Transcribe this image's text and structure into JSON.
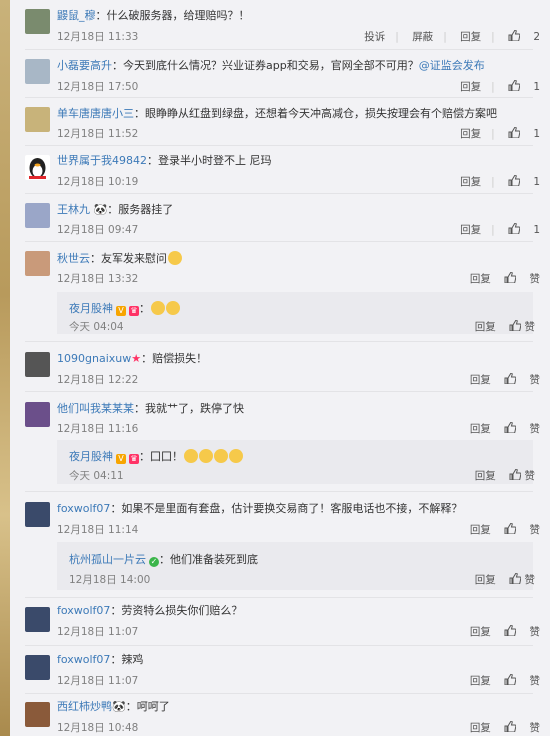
{
  "comments": [
    {
      "user": "鼹鼠_穆",
      "text": "：什么破服务器，给理赔吗？！",
      "time": "12月18日 11:33",
      "report": "投诉",
      "block": "屏蔽",
      "reply": "回复",
      "likes": "2",
      "avatar_color": "#7a8b6e"
    },
    {
      "user": "小磊要高升",
      "text": "：今天到底什么情况？兴业证券app和交易，官网全部不可用？",
      "link": "@证监会发布",
      "time": "12月18日 17:50",
      "reply": "回复",
      "likes": "1",
      "avatar_color": "#a8b7c6"
    },
    {
      "user": "单车唐唐唐小三",
      "text": "：眼睁睁从红盘到绿盘，还想着今天冲高减仓，损失按理会有个赔偿方案吧",
      "time": "12月18日 11:52",
      "reply": "回复",
      "likes": "1",
      "avatar_color": "#c8b37a"
    },
    {
      "user": "世界属于我49842",
      "text": "：登录半小时登不上 尼玛",
      "time": "12月18日 10:19",
      "reply": "回复",
      "likes": "1",
      "avatar_color": "#222222"
    },
    {
      "user": "王林九",
      "text": "：服务器挂了",
      "time": "12月18日 09:47",
      "reply": "回复",
      "likes": "1",
      "avatar_color": "#9aa6c8"
    },
    {
      "user": "秋世云",
      "text": "：友军发来慰问",
      "time": "12月18日 13:32",
      "reply": "回复",
      "like": "赞",
      "avatar_color": "#c99a7a",
      "sub": {
        "user": "夜月股神",
        "text": "：",
        "time": "今天 04:04",
        "reply": "回复",
        "like": "赞"
      }
    },
    {
      "user": "1090gnaixuw",
      "text": "：赔偿损失！",
      "time": "12月18日 12:22",
      "reply": "回复",
      "like": "赞",
      "avatar_color": "#555555"
    },
    {
      "user": "他们叫我某某某",
      "text": "：我就艹了，跌停了快",
      "time": "12月18日 11:16",
      "reply": "回复",
      "like": "赞",
      "avatar_color": "#6b4f8a",
      "sub": {
        "user": "夜月股神",
        "text": "：囗囗！",
        "time": "今天 04:11",
        "reply": "回复",
        "like": "赞"
      }
    },
    {
      "user": "foxwolf07",
      "text": "：如果不是里面有套盘，估计要换交易商了！客服电话也不接，不解释？",
      "time": "12月18日 11:14",
      "reply": "回复",
      "like": "赞",
      "avatar_color": "#3a4a6a",
      "sub": {
        "user": "杭州孤山一片云",
        "text": "：他们准备装死到底",
        "time": "12月18日 14:00",
        "reply": "回复",
        "like": "赞"
      }
    },
    {
      "user": "foxwolf07",
      "text": "：劳资特么损失你们赔么？",
      "time": "12月18日 11:07",
      "reply": "回复",
      "like": "赞",
      "avatar_color": "#3a4a6a"
    },
    {
      "user": "foxwolf07",
      "text": "：辣鸡",
      "time": "12月18日 11:07",
      "reply": "回复",
      "like": "赞",
      "avatar_color": "#3a4a6a"
    },
    {
      "user": "西红柿炒鸭",
      "text": "：呵呵了",
      "time": "12月18日 10:48",
      "reply": "回复",
      "like": "赞",
      "avatar_color": "#8a5a3a"
    }
  ]
}
